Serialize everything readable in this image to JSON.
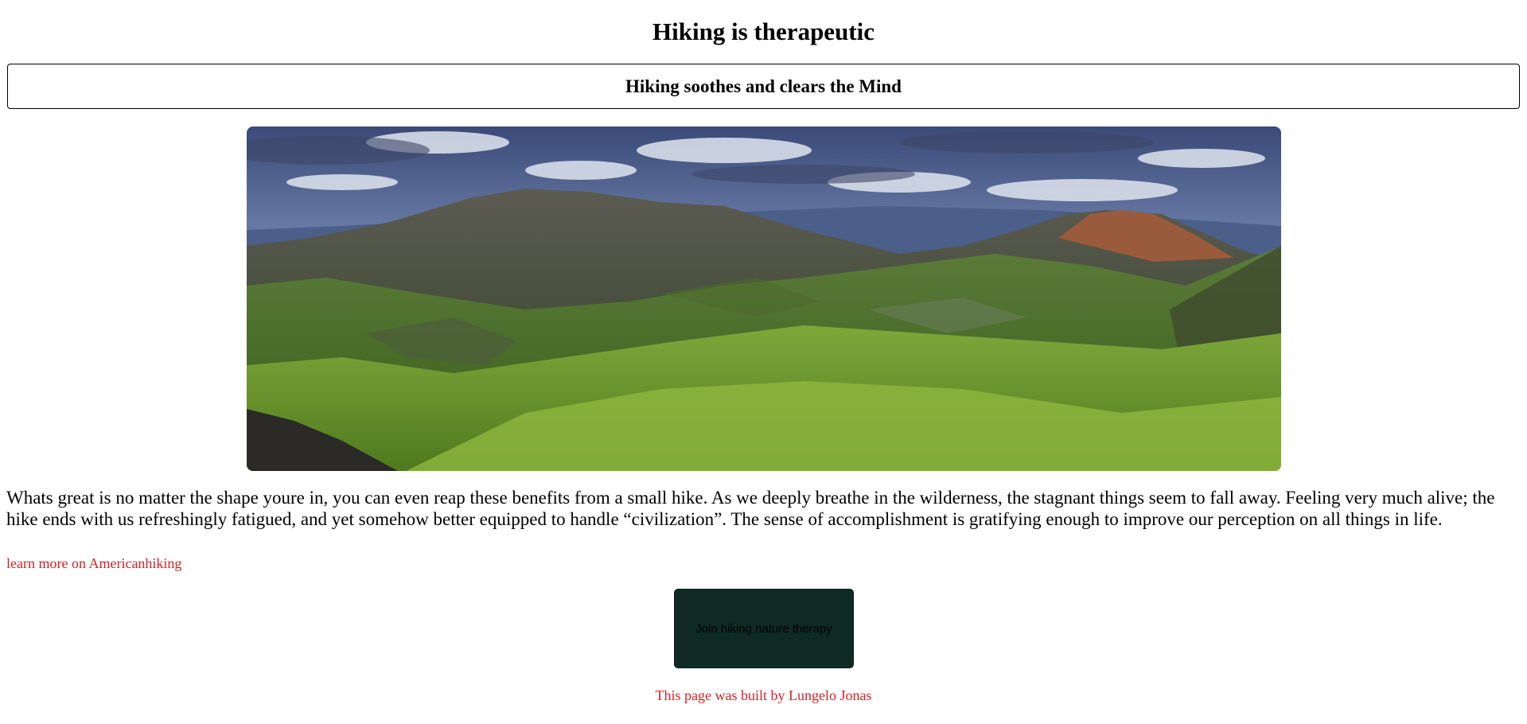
{
  "page": {
    "title": "Hiking is therapeutic",
    "subtitle": "Hiking soothes and clears the Mind"
  },
  "hero_image": {
    "description": "panoramic mountain landscape",
    "icon": "landscape-photo"
  },
  "content": {
    "paragraph": "Whats great is no matter the shape youre in, you can even reap these benefits from a small hike. As we deeply breathe in the wilderness, the stagnant things seem to fall away. Feeling very much alive; the hike ends with us refreshingly fatigued, and yet somehow better equipped to handle “civilization”. The sense of accomplishment is gratifying enough to improve our perception on all things in life.",
    "learn_more_link": "learn more on Americanhiking"
  },
  "actions": {
    "join_button": "Join hiking nature therapy"
  },
  "footer": {
    "credit": "This page was built by Lungelo Jonas"
  },
  "colors": {
    "link": "#d81f26",
    "button_bg": "#0f2a23"
  }
}
